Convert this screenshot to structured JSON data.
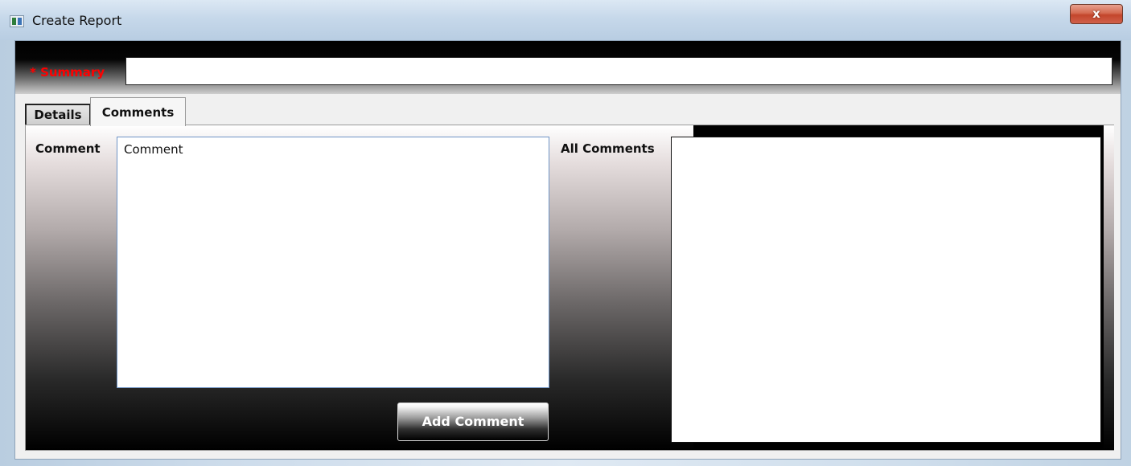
{
  "window": {
    "title": "Create Report",
    "close_label": "x",
    "icon": "app-window-icon"
  },
  "summary": {
    "label": "* Summary",
    "value": "",
    "required_color": "#ff0000"
  },
  "tabs": [
    {
      "label": "Details",
      "selected": false
    },
    {
      "label": "Comments",
      "selected": true
    }
  ],
  "comments_tab": {
    "comment_label": "Comment",
    "comment_value": "Comment",
    "add_button_label": "Add Comment",
    "all_comments_label": "All Comments",
    "all_comments_value": ""
  }
}
